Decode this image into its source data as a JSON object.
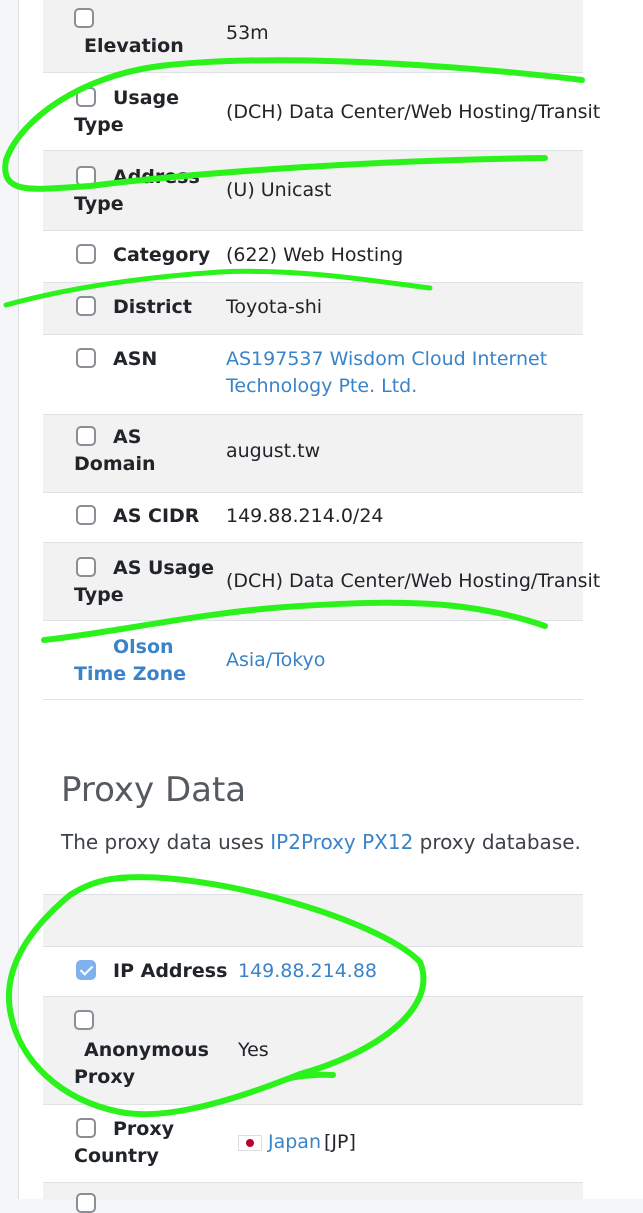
{
  "location_rows": [
    {
      "id": "elevation",
      "label": "Elevation",
      "value": "53m"
    },
    {
      "id": "usage-type",
      "label_line1": "Usage",
      "label_line2": "Type",
      "value": "(DCH) Data Center/Web Hosting/Transit"
    },
    {
      "id": "address-type",
      "label_line1": "Address",
      "label_line2": "Type",
      "value": "(U) Unicast"
    },
    {
      "id": "category",
      "label": "Category",
      "value": "(622) Web Hosting"
    },
    {
      "id": "district",
      "label": "District",
      "value": "Toyota-shi"
    },
    {
      "id": "asn",
      "label": "ASN",
      "value_line1": "AS197537 Wisdom Cloud Internet",
      "value_line2": "Technology Pte. Ltd."
    },
    {
      "id": "as-domain",
      "label_line1": "AS",
      "label_line2": "Domain",
      "value": "august.tw"
    },
    {
      "id": "as-cidr",
      "label": "AS CIDR",
      "value": "149.88.214.0/24"
    },
    {
      "id": "as-usage-type",
      "label_line1": "AS Usage",
      "label_line2": "Type",
      "value": "(DCH) Data Center/Web Hosting/Transit"
    },
    {
      "id": "olson",
      "label_line1": "Olson",
      "label_line2": "Time Zone",
      "value": "Asia/Tokyo"
    }
  ],
  "proxy_section": {
    "title": "Proxy Data",
    "desc_prefix": "The proxy data uses ",
    "desc_link": "IP2Proxy PX12",
    "desc_suffix": " proxy database."
  },
  "proxy_rows": [
    {
      "id": "ip-address",
      "label": "IP Address",
      "value": "149.88.214.88",
      "checked": true
    },
    {
      "id": "anonymous-proxy",
      "label_line1": "Anonymous",
      "label_line2": "Proxy",
      "value": "Yes",
      "checked": false
    },
    {
      "id": "proxy-country",
      "label_line1": "Proxy",
      "label_line2": "Country",
      "country_name": "Japan",
      "country_code": "[JP]",
      "checked": false
    }
  ],
  "colors": {
    "link": "#3a83c9",
    "stripe": "#f2f2f2",
    "annotation": "#2bf21a",
    "checkbox_checked": "#7fb2ec"
  }
}
